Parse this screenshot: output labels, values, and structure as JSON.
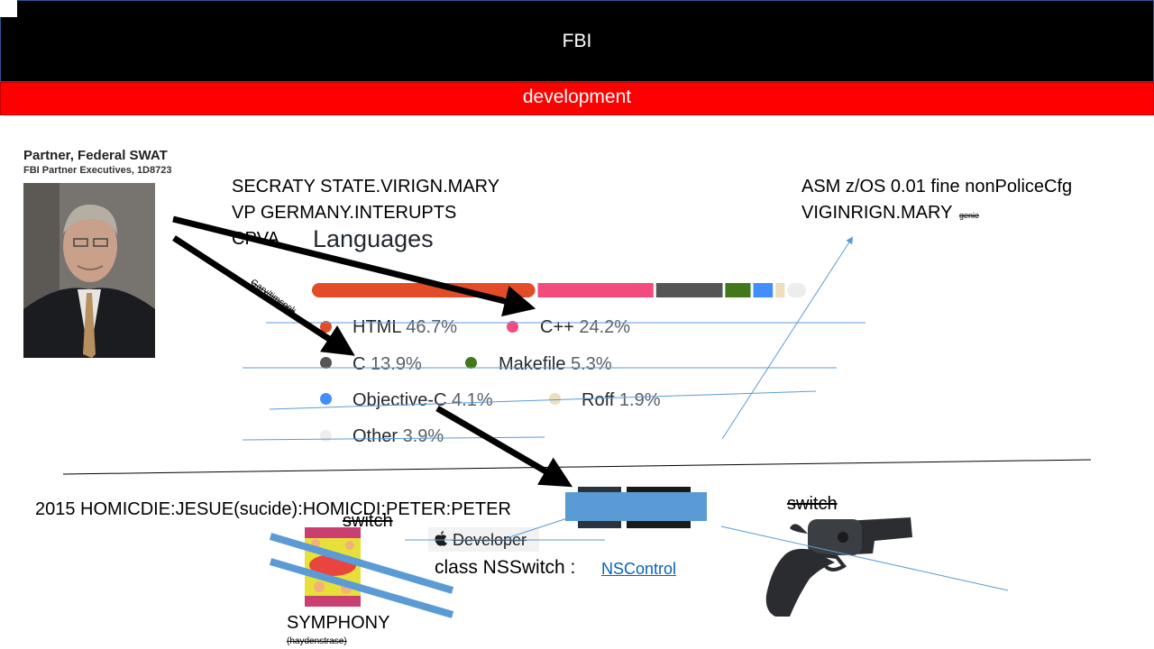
{
  "header": {
    "title": "FBI",
    "subtitle": "development"
  },
  "profile": {
    "title": "Partner, Federal SWAT",
    "subtitle": "FBI Partner Executives, 1D8723"
  },
  "notes_left": [
    "SECRATY STATE.VIRIGN.MARY",
    "VP GERMANY.INTERUPTS",
    "CPVA"
  ],
  "notes_right": [
    "ASM z/OS 0.01 fine nonPoliceCfg",
    "VIGINRIGN.MARY"
  ],
  "tiny_labels": {
    "genie": "genie",
    "gary": "Gary/timcook",
    "haydens": "(haydenstrase)"
  },
  "languages": {
    "title": "Languages",
    "items": [
      {
        "name": "HTML",
        "pct": "46.7%",
        "value": 46.7,
        "color": "#e34c26"
      },
      {
        "name": "C++",
        "pct": "24.2%",
        "value": 24.2,
        "color": "#f34b7d"
      },
      {
        "name": "C",
        "pct": "13.9%",
        "value": 13.9,
        "color": "#555555"
      },
      {
        "name": "Makefile",
        "pct": "5.3%",
        "value": 5.3,
        "color": "#427819"
      },
      {
        "name": "Objective-C",
        "pct": "4.1%",
        "value": 4.1,
        "color": "#438eff"
      },
      {
        "name": "Roff",
        "pct": "1.9%",
        "value": 1.9,
        "color": "#ecdebe"
      },
      {
        "name": "Other",
        "pct": "3.9%",
        "value": 3.9,
        "color": "#ededed"
      }
    ]
  },
  "homicide_text": "2015 HOMICDIE:JESUE(sucide):HOMICDI:PETER:PETER",
  "switch_labels": [
    "switch",
    "switch"
  ],
  "developer": {
    "badge": "Developer",
    "class_text": "class NSSwitch :",
    "link": "NSControl"
  },
  "symphony": "SYMPHONY",
  "colors": {
    "accent_blue": "#5b9bd5",
    "red_bar": "#ff0000",
    "header": "#000000"
  }
}
